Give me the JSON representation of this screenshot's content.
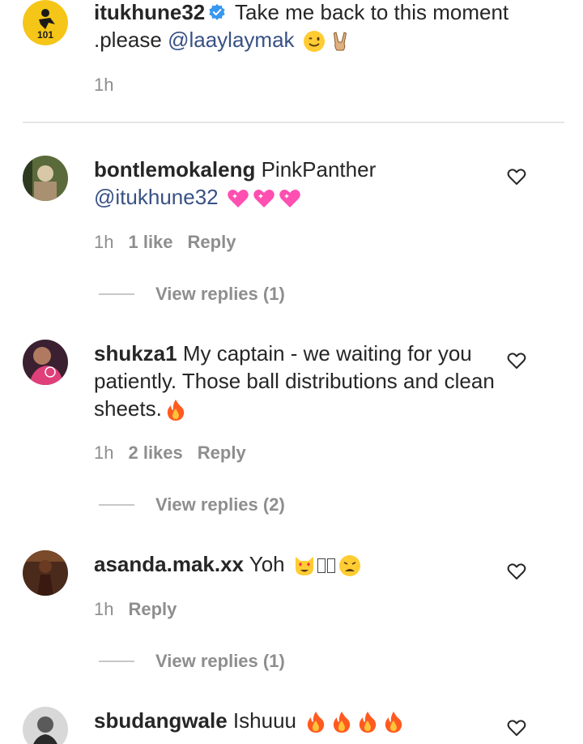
{
  "caption": {
    "username": "itukhune32",
    "text": " Take me back to this moment .please ",
    "mention": "@laaylaymak",
    "time": "1h",
    "avatar_badge": "101"
  },
  "comments": [
    {
      "username": "bontlemokaleng",
      "text": " PinkPanther ",
      "mention": "@itukhune32",
      "emoji": [
        "sparkling-heart",
        "sparkling-heart",
        "sparkling-heart"
      ],
      "time": "1h",
      "likes": "1 like",
      "reply": "Reply",
      "view_replies": "View replies (1)"
    },
    {
      "username": "shukza1",
      "text": " My captain - we waiting for you patiently. Those ball distributions and clean sheets.",
      "emoji": [
        "fire"
      ],
      "time": "1h",
      "likes": "2 likes",
      "reply": "Reply",
      "view_replies": "View replies (2)"
    },
    {
      "username": "asanda.mak.xx",
      "text": " Yoh ",
      "emoji": [
        "heart-eyes-cat",
        "missing-glyph",
        "missing-glyph",
        "weary-face"
      ],
      "time": "1h",
      "reply": "Reply",
      "view_replies": "View replies (1)"
    },
    {
      "username": "sbudangwale",
      "text": " Ishuuu ",
      "emoji": [
        "fire",
        "fire",
        "fire",
        "fire"
      ]
    }
  ],
  "colors": {
    "text": "#262626",
    "meta": "#8e8e8e",
    "mention": "#385185",
    "verified": "#3897f0"
  }
}
